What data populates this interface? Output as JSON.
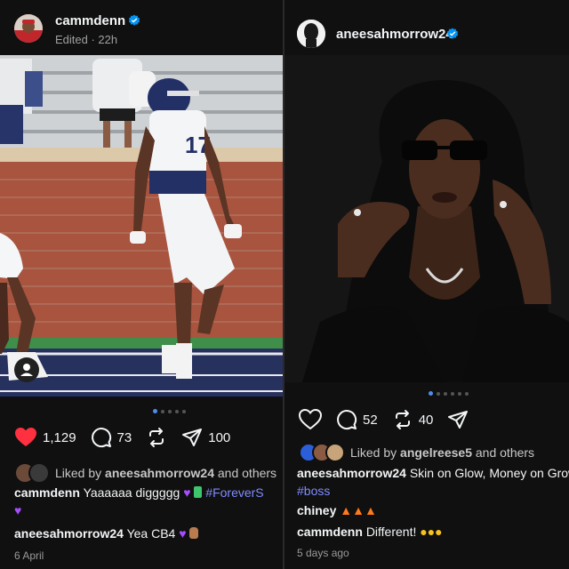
{
  "left": {
    "username": "cammdenn",
    "meta": "Edited · 22h",
    "likes": "1,129",
    "comments": "73",
    "shares": "100",
    "liked_by_prefix": "Liked by",
    "liked_by_user": "aneesahmorrow24",
    "liked_by_suffix": "and others",
    "caption_user": "cammdenn",
    "caption_text": "Yaaaaaa diggggg",
    "caption_tag": "#ForeverS",
    "comment_user": "aneesahmorrow24",
    "comment_text": "Yea CB4",
    "date": "6 April",
    "jersey_number": "17",
    "colors": {
      "heart": "#ff3040",
      "verified": "#0095f6",
      "brick": "#a9543f",
      "field": "#27315e"
    },
    "icons": [
      "heart-filled-icon",
      "comment-icon",
      "repost-icon",
      "share-icon",
      "verified-icon",
      "person-icon"
    ]
  },
  "right": {
    "username": "aneesahmorrow24",
    "comments": "52",
    "reposts": "40",
    "liked_by_prefix": "Liked by",
    "liked_by_user": "angelreese5",
    "liked_by_suffix": "and others",
    "caption_user": "aneesahmorrow24",
    "caption_text": "Skin on Glow, Money on Grow",
    "caption_tag": "#boss",
    "comment1_user": "chiney",
    "comment2_user": "cammdenn",
    "comment2_text": "Different!",
    "date": "5 days ago",
    "icons": [
      "heart-outline-icon",
      "comment-icon",
      "repost-icon",
      "share-icon",
      "verified-icon"
    ]
  }
}
